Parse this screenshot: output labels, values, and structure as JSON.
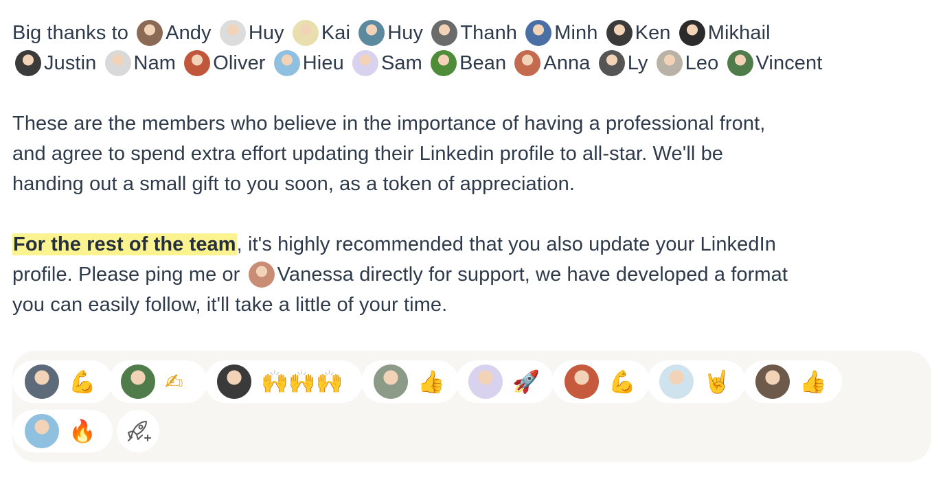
{
  "intro": {
    "prefix": "Big thanks to",
    "members_row1": [
      {
        "name": "Andy",
        "color": "#8a6a55"
      },
      {
        "name": "Huy",
        "color": "#dcdcdc"
      },
      {
        "name": "Kai",
        "color": "#e9dfae"
      },
      {
        "name": "Huy",
        "color": "#5b8aa0"
      },
      {
        "name": "Thanh",
        "color": "#6b6b6b"
      },
      {
        "name": "Minh",
        "color": "#4a6fa5"
      },
      {
        "name": "Ken",
        "color": "#3a3a3a"
      },
      {
        "name": "Mikhail",
        "color": "#2b2b2b"
      }
    ],
    "members_row2": [
      {
        "name": "Justin",
        "color": "#3b3b3b"
      },
      {
        "name": "Nam",
        "color": "#d9d9d9"
      },
      {
        "name": "Oliver",
        "color": "#c0573a"
      },
      {
        "name": "Hieu",
        "color": "#8fc0e0"
      },
      {
        "name": "Sam",
        "color": "#d8d2ee"
      },
      {
        "name": "Bean",
        "color": "#4e8c3a"
      },
      {
        "name": "Anna",
        "color": "#c46a4f"
      },
      {
        "name": "Ly",
        "color": "#555555"
      },
      {
        "name": "Leo",
        "color": "#b9b2a6"
      },
      {
        "name": "Vincent",
        "color": "#4f7c4a"
      }
    ]
  },
  "paragraph2": {
    "line1": "These are the members who believe in the importance of having a professional front,",
    "line2": "and agree to spend extra effort updating their Linkedin profile to all-star. We'll be",
    "line3": "handing out a small gift to you soon, as a token of appreciation."
  },
  "paragraph3": {
    "highlight": "For the rest of the team",
    "line1_rest": ", it's highly recommended that you also update your LinkedIn",
    "line2_before": "profile. Please ping me or",
    "mention_name": "Vanessa",
    "mention_color": "#c98d76",
    "line2_after": " directly for support, we have developed a format",
    "line3": "you can easily follow, it'll take a little of your time."
  },
  "reactions": [
    {
      "emoji": "💪",
      "avatar_color": "#5c6a7a"
    },
    {
      "emoji": "✍",
      "avatar_color": "#4f7c4a"
    },
    {
      "emoji": "🙌🙌🙌",
      "avatar_color": "#3a3a3a"
    },
    {
      "emoji": "👍",
      "avatar_color": "#8c9a88"
    },
    {
      "emoji": "🚀",
      "avatar_color": "#d8d2ee"
    },
    {
      "emoji": "💪",
      "avatar_color": "#c65a3c"
    },
    {
      "emoji": "🤘",
      "avatar_color": "#cfe3ee"
    },
    {
      "emoji": "👍",
      "avatar_color": "#6e5a4a"
    },
    {
      "emoji": "🔥",
      "avatar_color": "#8fc0e0"
    }
  ],
  "add_reaction_icon": "rocket-add-icon"
}
